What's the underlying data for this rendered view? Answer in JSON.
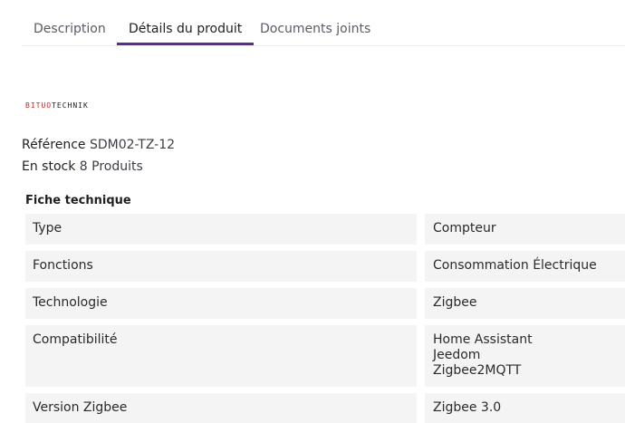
{
  "tabs": [
    {
      "label": "Description",
      "active": false
    },
    {
      "label": "Détails du produit",
      "active": true
    },
    {
      "label": "Documents joints",
      "active": false
    }
  ],
  "accent_color": "#5b2d91",
  "brand": {
    "part1": "BITUO",
    "part2": "TECHNIK",
    "part1_color": "#d32020"
  },
  "product": {
    "reference_label": "Référence",
    "reference_value": "SDM02-TZ-12",
    "stock_label": "En stock",
    "stock_value": "8 Produits"
  },
  "sheet": {
    "title": "Fiche technique",
    "rows": [
      {
        "name": "Type",
        "values": [
          "Compteur"
        ]
      },
      {
        "name": "Fonctions",
        "values": [
          "Consommation Électrique"
        ]
      },
      {
        "name": "Technologie",
        "values": [
          "Zigbee"
        ]
      },
      {
        "name": "Compatibilité",
        "values": [
          "Home Assistant",
          "Jeedom",
          "Zigbee2MQTT"
        ]
      },
      {
        "name": "Version Zigbee",
        "values": [
          "Zigbee 3.0"
        ]
      }
    ]
  }
}
